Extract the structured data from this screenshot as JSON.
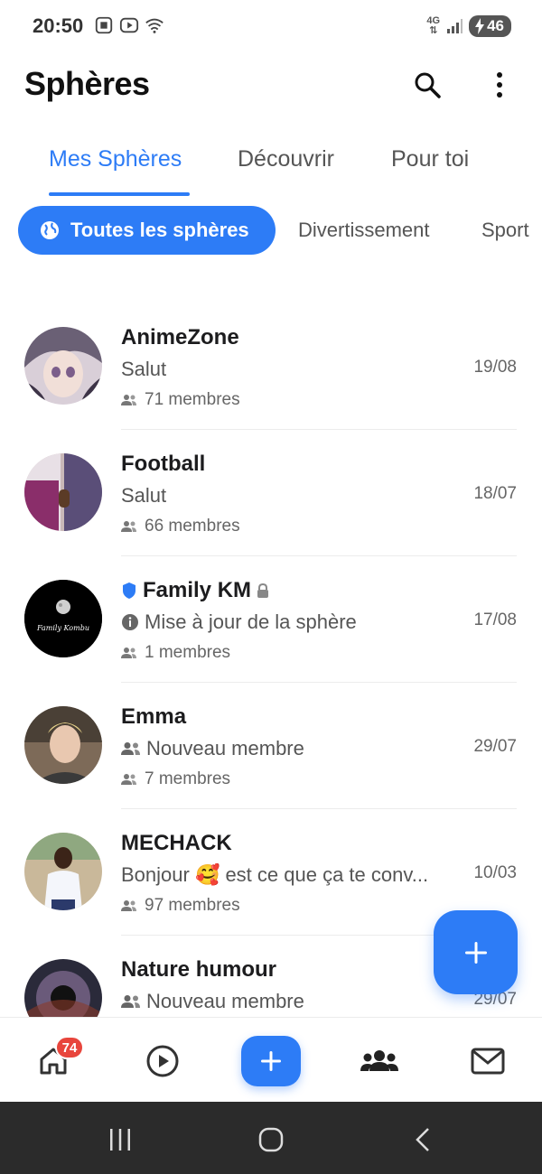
{
  "status_bar": {
    "time": "20:50",
    "network": "4G",
    "battery": "46"
  },
  "header": {
    "title": "Sphères"
  },
  "tabs": [
    {
      "label": "Mes Sphères",
      "active": true
    },
    {
      "label": "Découvrir",
      "active": false
    },
    {
      "label": "Pour toi",
      "active": false
    }
  ],
  "chips": [
    {
      "label": "Toutes les sphères",
      "active": true
    },
    {
      "label": "Divertissement",
      "active": false
    },
    {
      "label": "Sport",
      "active": false
    }
  ],
  "spheres": [
    {
      "name": "AnimeZone",
      "message": "Salut",
      "members": "71 membres",
      "date": "19/08"
    },
    {
      "name": "Football",
      "message": "Salut",
      "members": "66 membres",
      "date": "18/07"
    },
    {
      "name": "Family KM",
      "message": "Mise à jour de la sphère",
      "members": "1 membres",
      "date": "17/08",
      "avatar_text": "Family Kombu"
    },
    {
      "name": "Emma",
      "message": "Nouveau membre",
      "members": "7 membres",
      "date": "29/07"
    },
    {
      "name": "MECHACK",
      "message": "Bonjour 🥰 est ce que ça te conv...",
      "members": "97 membres",
      "date": "10/03"
    },
    {
      "name": "Nature humour",
      "message": "Nouveau membre",
      "members": "",
      "date": "29/07"
    }
  ],
  "bottom_nav": {
    "home_badge": "74"
  },
  "colors": {
    "accent": "#2d7cf6",
    "badge": "#e8453c",
    "system_nav": "#2b2b2b"
  }
}
